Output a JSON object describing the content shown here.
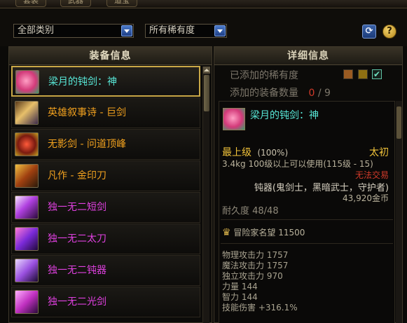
{
  "top_tabs": [
    "套装",
    "武器",
    "道宝"
  ],
  "filters": {
    "category": "全部类别",
    "rarity": "所有稀有度"
  },
  "colors": {
    "selected_border": "#c9a847",
    "legendary_orange": "#f0a01e",
    "epic_magenta": "#e040e0",
    "name_cyan": "#58e8d8",
    "unique_gold": "#f0c23a",
    "red": "#d23a2a",
    "header_text": "#e4dcc2"
  },
  "left_panel": {
    "header": "装备信息",
    "items": [
      {
        "name": "梁月的钝剑：神",
        "color": "#58e8d8",
        "icon": "blunt-sword-icon",
        "selected": true
      },
      {
        "name": "英雄叙事诗 - 巨剑",
        "color": "#f0a01e",
        "icon": "greatsword-icon",
        "selected": false
      },
      {
        "name": "无影剑 - 问道顶峰",
        "color": "#f0a01e",
        "icon": "shadow-sword-icon",
        "selected": false
      },
      {
        "name": "凡作 - 金印刀",
        "color": "#f0a01e",
        "icon": "golden-blade-icon",
        "selected": false
      },
      {
        "name": "独一无二短剑",
        "color": "#e040e0",
        "icon": "shortsword-icon",
        "selected": false
      },
      {
        "name": "独一无二太刀",
        "color": "#e040e0",
        "icon": "katana-icon",
        "selected": false
      },
      {
        "name": "独一无二钝器",
        "color": "#e040e0",
        "icon": "blunt-weapon-icon",
        "selected": false
      },
      {
        "name": "独一无二光剑",
        "color": "#e040e0",
        "icon": "lightsaber-icon",
        "selected": false
      }
    ]
  },
  "right_panel": {
    "header": "详细信息",
    "added_rarity_label": "已添加的稀有度",
    "added_count_label": "添加的装备数量",
    "added_count": "0",
    "added_count_sep": " / ",
    "added_count_max": "9",
    "detail": {
      "name": "梁月的钝剑：神",
      "grade": "最上级",
      "grade_pct": "(100%)",
      "tier": "太初",
      "weight_req": "3.4kg  100级以上可以使用(115级 - 15)",
      "trade": "无法交易",
      "weapon_type": "钝器(鬼剑士，黑暗武士，守护者)",
      "price": "43,920金币",
      "durability": "耐久度 48/48",
      "fame": "冒险家名望  11500",
      "stats": [
        "物理攻击力 1757",
        "魔法攻击力 1757",
        "独立攻击力 970",
        "力量 144",
        "智力 144",
        "技能伤害 +316.1%"
      ]
    }
  }
}
